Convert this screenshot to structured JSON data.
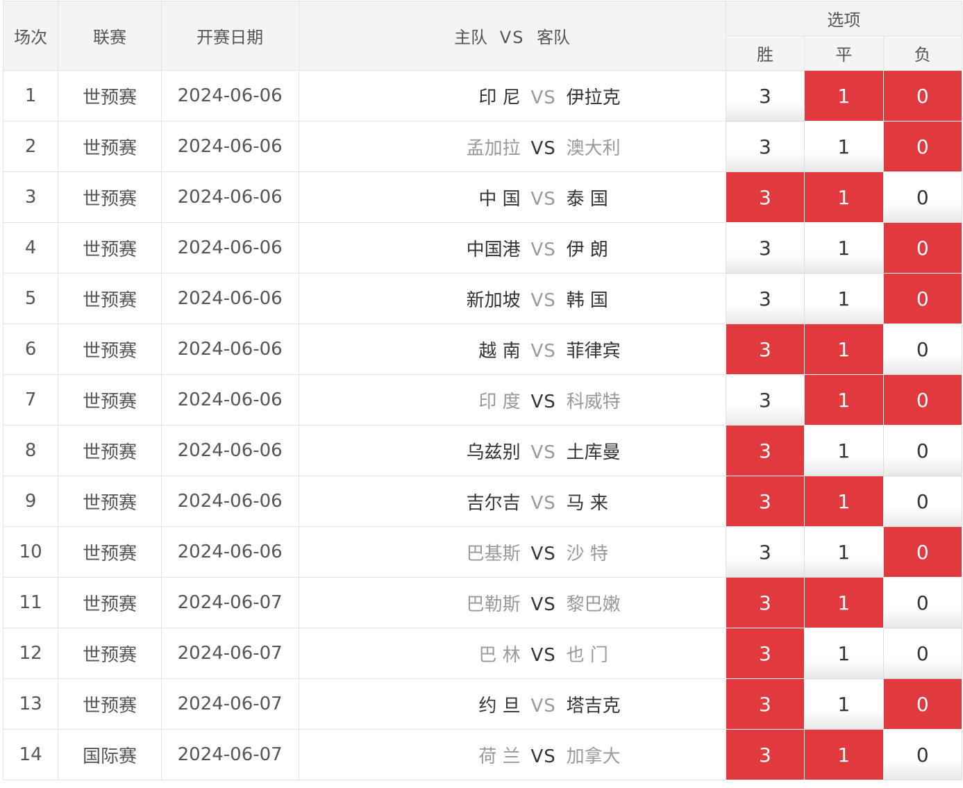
{
  "header": {
    "col_num": "场次",
    "col_league": "联赛",
    "col_date": "开赛日期",
    "col_home": "主队",
    "col_vs": "VS",
    "col_away": "客队",
    "options_title": "选项",
    "opt_win": "胜",
    "opt_draw": "平",
    "opt_lose": "负"
  },
  "colors": {
    "selected": "#e0393e",
    "unselected": "#ffffff"
  },
  "rows": [
    {
      "num": "1",
      "league": "世预赛",
      "date": "2024-06-06",
      "home": "印 尼",
      "vs": "VS",
      "away": "伊拉克",
      "vs_light": true,
      "win": "3",
      "draw": "1",
      "lose": "0",
      "sel": [
        false,
        true,
        true
      ]
    },
    {
      "num": "2",
      "league": "世预赛",
      "date": "2024-06-06",
      "home": "孟加拉",
      "vs": "VS",
      "away": "澳大利",
      "vs_light": false,
      "win": "3",
      "draw": "1",
      "lose": "0",
      "sel": [
        false,
        false,
        true
      ]
    },
    {
      "num": "3",
      "league": "世预赛",
      "date": "2024-06-06",
      "home": "中 国",
      "vs": "VS",
      "away": "泰 国",
      "vs_light": true,
      "win": "3",
      "draw": "1",
      "lose": "0",
      "sel": [
        true,
        true,
        false
      ]
    },
    {
      "num": "4",
      "league": "世预赛",
      "date": "2024-06-06",
      "home": "中国港",
      "vs": "VS",
      "away": "伊 朗",
      "vs_light": true,
      "win": "3",
      "draw": "1",
      "lose": "0",
      "sel": [
        false,
        false,
        true
      ]
    },
    {
      "num": "5",
      "league": "世预赛",
      "date": "2024-06-06",
      "home": "新加坡",
      "vs": "VS",
      "away": "韩 国",
      "vs_light": true,
      "win": "3",
      "draw": "1",
      "lose": "0",
      "sel": [
        false,
        false,
        true
      ]
    },
    {
      "num": "6",
      "league": "世预赛",
      "date": "2024-06-06",
      "home": "越 南",
      "vs": "VS",
      "away": "菲律宾",
      "vs_light": true,
      "win": "3",
      "draw": "1",
      "lose": "0",
      "sel": [
        true,
        true,
        false
      ]
    },
    {
      "num": "7",
      "league": "世预赛",
      "date": "2024-06-06",
      "home": "印 度",
      "vs": "VS",
      "away": "科威特",
      "vs_light": false,
      "win": "3",
      "draw": "1",
      "lose": "0",
      "sel": [
        false,
        true,
        true
      ]
    },
    {
      "num": "8",
      "league": "世预赛",
      "date": "2024-06-06",
      "home": "乌兹别",
      "vs": "VS",
      "away": "土库曼",
      "vs_light": true,
      "win": "3",
      "draw": "1",
      "lose": "0",
      "sel": [
        true,
        false,
        false
      ]
    },
    {
      "num": "9",
      "league": "世预赛",
      "date": "2024-06-06",
      "home": "吉尔吉",
      "vs": "VS",
      "away": "马 来",
      "vs_light": true,
      "win": "3",
      "draw": "1",
      "lose": "0",
      "sel": [
        true,
        true,
        false
      ]
    },
    {
      "num": "10",
      "league": "世预赛",
      "date": "2024-06-06",
      "home": "巴基斯",
      "vs": "VS",
      "away": "沙 特",
      "vs_light": false,
      "win": "3",
      "draw": "1",
      "lose": "0",
      "sel": [
        false,
        false,
        true
      ]
    },
    {
      "num": "11",
      "league": "世预赛",
      "date": "2024-06-07",
      "home": "巴勒斯",
      "vs": "VS",
      "away": "黎巴嫩",
      "vs_light": false,
      "win": "3",
      "draw": "1",
      "lose": "0",
      "sel": [
        true,
        true,
        false
      ]
    },
    {
      "num": "12",
      "league": "世预赛",
      "date": "2024-06-07",
      "home": "巴 林",
      "vs": "VS",
      "away": "也 门",
      "vs_light": false,
      "win": "3",
      "draw": "1",
      "lose": "0",
      "sel": [
        true,
        false,
        false
      ]
    },
    {
      "num": "13",
      "league": "世预赛",
      "date": "2024-06-07",
      "home": "约 旦",
      "vs": "VS",
      "away": "塔吉克",
      "vs_light": true,
      "win": "3",
      "draw": "1",
      "lose": "0",
      "sel": [
        true,
        false,
        true
      ]
    },
    {
      "num": "14",
      "league": "国际赛",
      "date": "2024-06-07",
      "home": "荷 兰",
      "vs": "VS",
      "away": "加拿大",
      "vs_light": false,
      "win": "3",
      "draw": "1",
      "lose": "0",
      "sel": [
        true,
        true,
        false
      ]
    }
  ]
}
